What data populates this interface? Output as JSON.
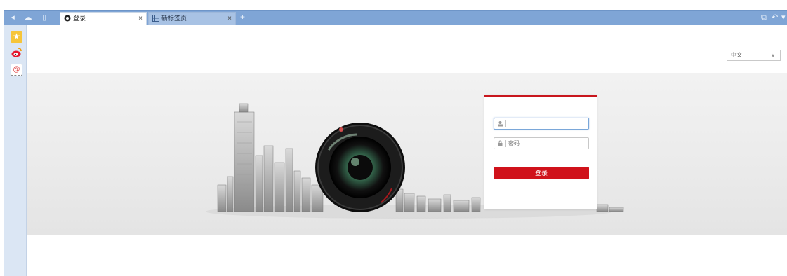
{
  "browser": {
    "tabs": [
      {
        "label": "登录",
        "active": true
      },
      {
        "label": "新标签页",
        "active": false
      }
    ],
    "close_glyph": "×",
    "new_tab_glyph": "+"
  },
  "sidebar": {
    "items": [
      {
        "icon": "star-icon"
      },
      {
        "icon": "weibo-icon"
      },
      {
        "icon": "mail-icon",
        "glyph": "@"
      }
    ]
  },
  "page": {
    "language_select": {
      "value": "中文"
    },
    "login": {
      "username_value": "",
      "password_placeholder": "密码",
      "button_label": "登录"
    }
  },
  "colors": {
    "tabbar": "#7fa5d6",
    "accent_red": "#d0121b",
    "sidebar": "#dbe6f4"
  }
}
